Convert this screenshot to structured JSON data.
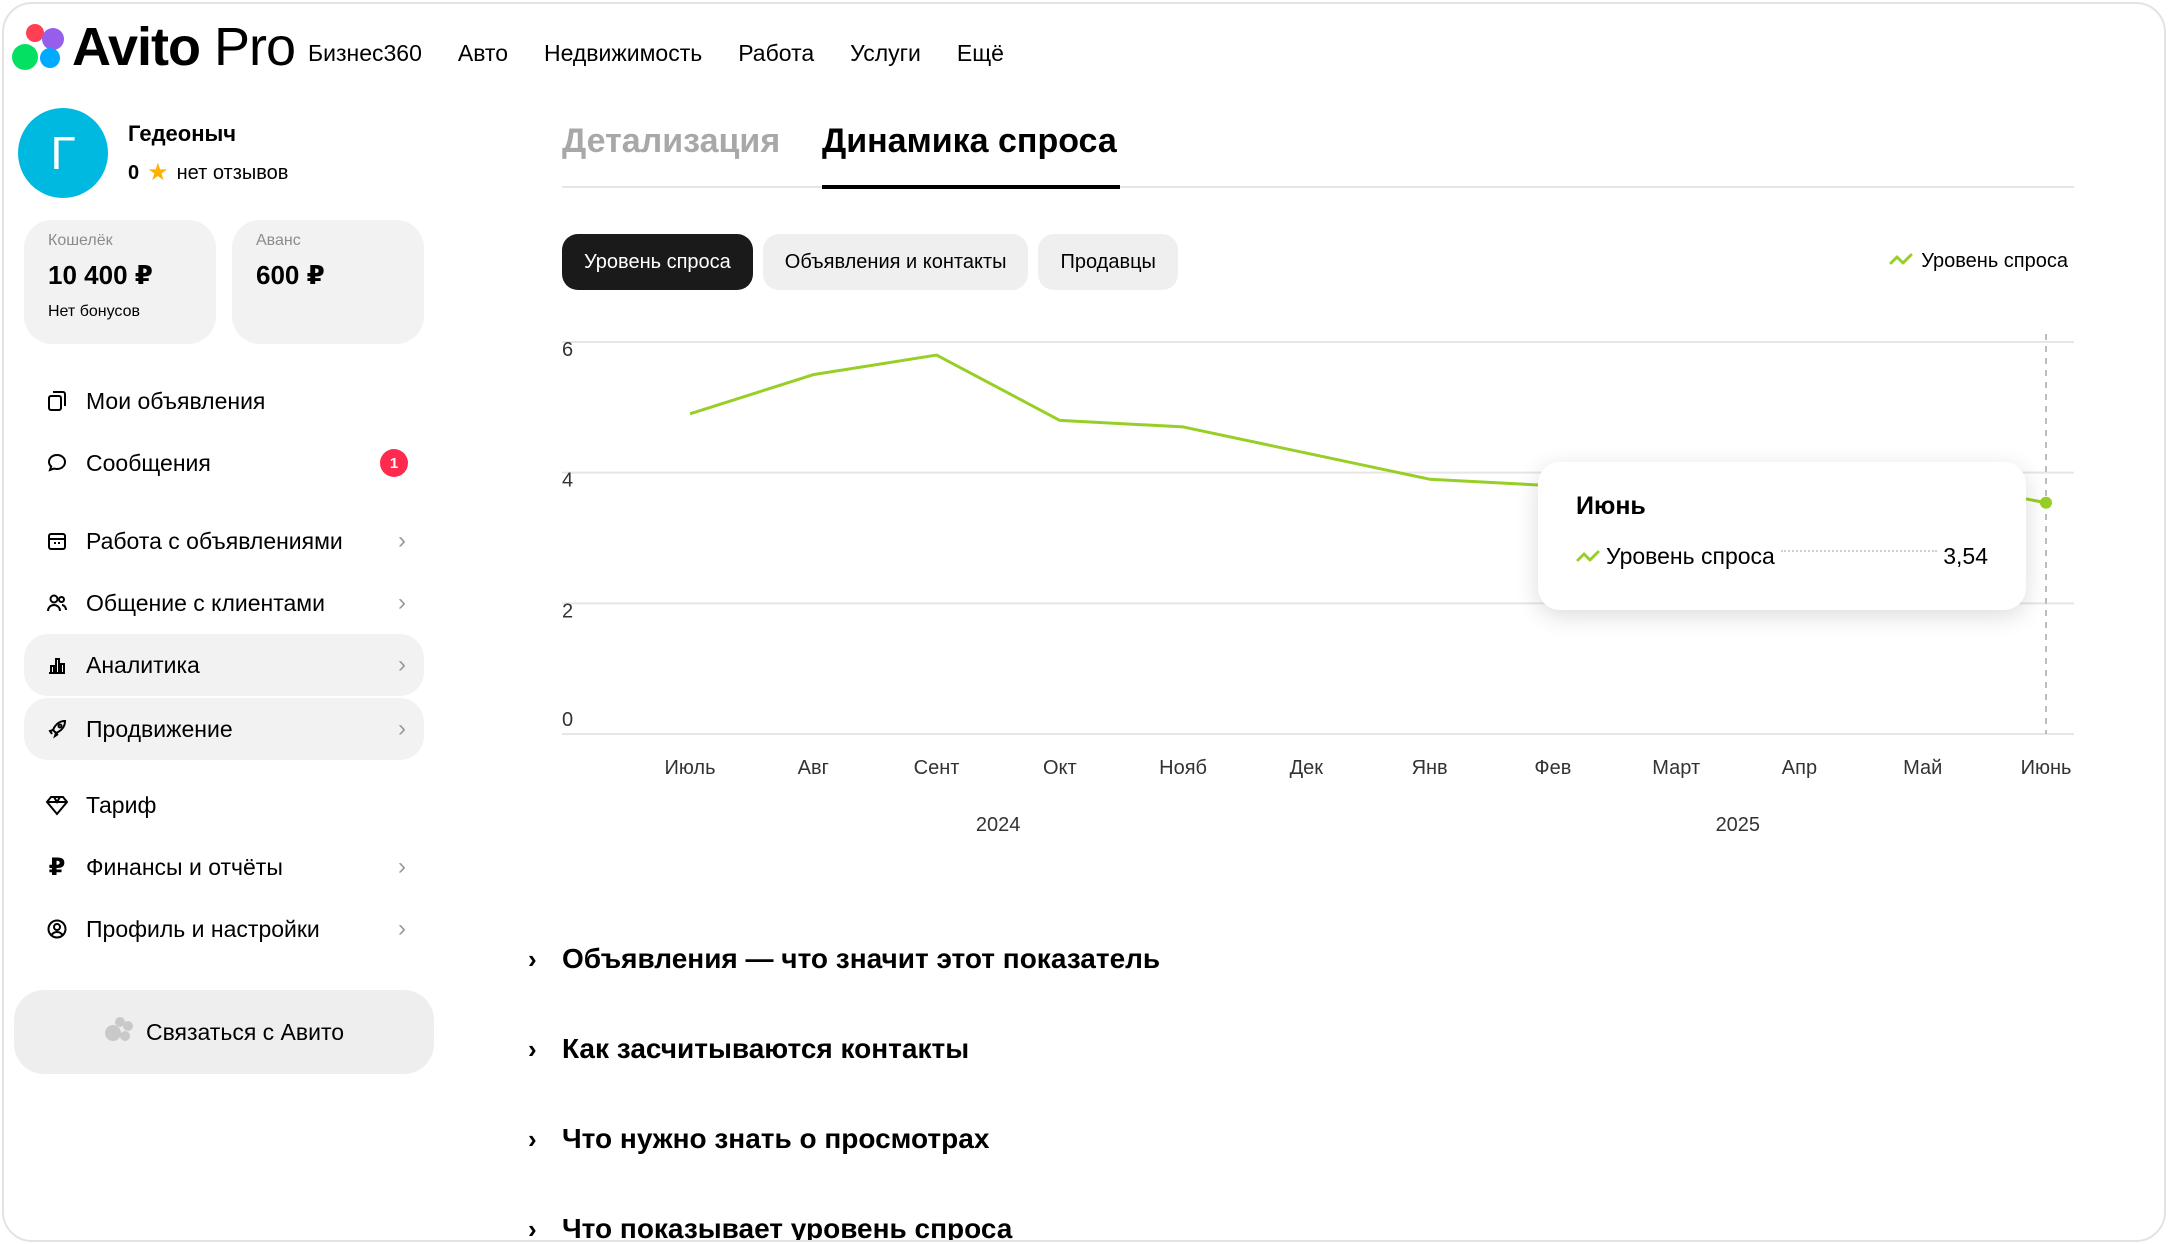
{
  "header": {
    "logo_text": "Avito",
    "logo_suffix": "Pro",
    "nav": [
      "Бизнес360",
      "Авто",
      "Недвижимость",
      "Работа",
      "Услуги",
      "Ещё"
    ]
  },
  "profile": {
    "avatar_letter": "Г",
    "name": "Гедеоныч",
    "rating": "0",
    "reviews": "нет отзывов"
  },
  "wallet": {
    "label": "Кошелёк",
    "value": "10 400 ₽",
    "sub": "Нет бонусов"
  },
  "advance": {
    "label": "Аванс",
    "value": "600 ₽"
  },
  "menu": [
    {
      "label": "Мои объявления",
      "icon": "ads-icon"
    },
    {
      "label": "Сообщения",
      "icon": "chat-icon",
      "badge": "1"
    },
    {
      "label": "Работа с объявлениями",
      "icon": "calendar-icon",
      "chevron": true
    },
    {
      "label": "Общение с клиентами",
      "icon": "users-icon",
      "chevron": true
    },
    {
      "label": "Аналитика",
      "icon": "chart-icon",
      "chevron": true,
      "active": true
    },
    {
      "label": "Продвижение",
      "icon": "rocket-icon",
      "chevron": true,
      "active": true
    },
    {
      "label": "Тариф",
      "icon": "diamond-icon"
    },
    {
      "label": "Финансы и отчёты",
      "icon": "ruble-icon",
      "chevron": true
    },
    {
      "label": "Профиль и настройки",
      "icon": "profile-icon",
      "chevron": true
    }
  ],
  "contact_button": "Связаться с Авито",
  "tabs": [
    "Детализация",
    "Динамика спроса"
  ],
  "pills": [
    "Уровень спроса",
    "Объявления и контакты",
    "Продавцы"
  ],
  "legend": "Уровень спроса",
  "colors": {
    "accent": "#97cf26",
    "badge": "#ff2a4e",
    "avatar": "#00b9e1"
  },
  "chart_data": {
    "type": "line",
    "categories": [
      "Июль",
      "Авг",
      "Сент",
      "Окт",
      "Нояб",
      "Дек",
      "Янв",
      "Фев",
      "Март",
      "Апр",
      "Май",
      "Июнь"
    ],
    "years": [
      {
        "label": "2024"
      },
      {
        "label": "2025"
      }
    ],
    "series": [
      {
        "name": "Уровень спроса",
        "values": [
          4.9,
          5.5,
          5.8,
          4.8,
          4.7,
          4.3,
          3.9,
          3.8,
          3.75,
          3.65,
          3.9,
          3.54
        ]
      }
    ],
    "y_ticks": [
      0,
      2,
      4,
      6
    ],
    "ylim": [
      0,
      6
    ],
    "grid": true
  },
  "tooltip": {
    "title": "Июнь",
    "label": "Уровень спроса",
    "value": "3,54"
  },
  "faq": [
    "Объявления — что значит этот показатель",
    "Как засчитываются контакты",
    "Что нужно знать о просмотрах",
    "Что показывает уровень спроса"
  ]
}
